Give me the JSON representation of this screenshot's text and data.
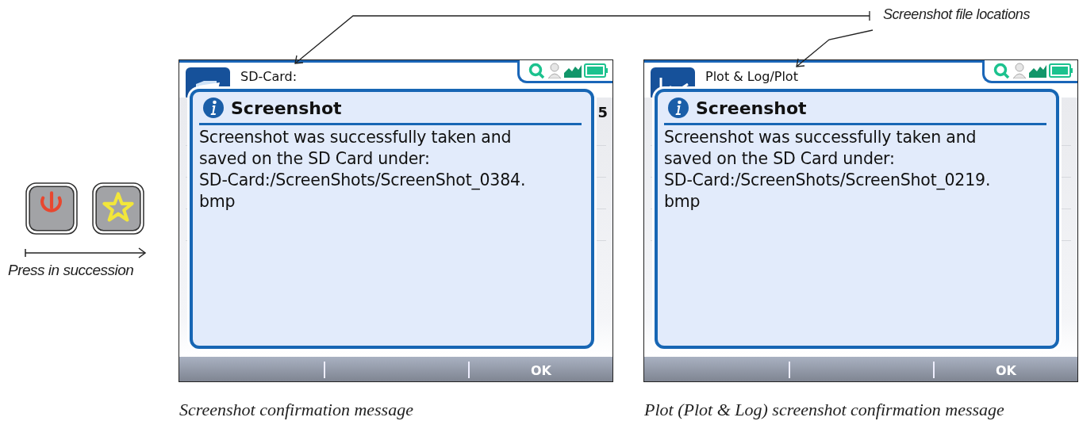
{
  "annotation": {
    "label": "Screenshot file locations"
  },
  "key_sequence": {
    "keys": [
      {
        "kind": "power"
      },
      {
        "kind": "star"
      }
    ],
    "caption": "Press in succession"
  },
  "screens": [
    {
      "path": "SD-Card:",
      "app_icon": {
        "kind": "folder"
      },
      "edge_text": "5",
      "dialog": {
        "title": "Screenshot",
        "message_lines": [
          "Screenshot was successfully taken and",
          "saved on the SD Card under:",
          "SD-Card:/ScreenShots/ScreenShot_0384.",
          "bmp"
        ]
      },
      "softkey": "OK",
      "caption": "Screenshot confirmation message"
    },
    {
      "path": "Plot & Log/Plot",
      "app_icon": {
        "kind": "plot"
      },
      "dialog": {
        "title": "Screenshot",
        "message_lines": [
          "Screenshot was successfully taken and",
          "saved on the SD Card under:",
          "SD-Card:/ScreenShots/ScreenShot_0219.",
          "bmp"
        ]
      },
      "softkey": "OK",
      "caption": "Plot (Plot & Log) screenshot confirmation message"
    }
  ]
}
